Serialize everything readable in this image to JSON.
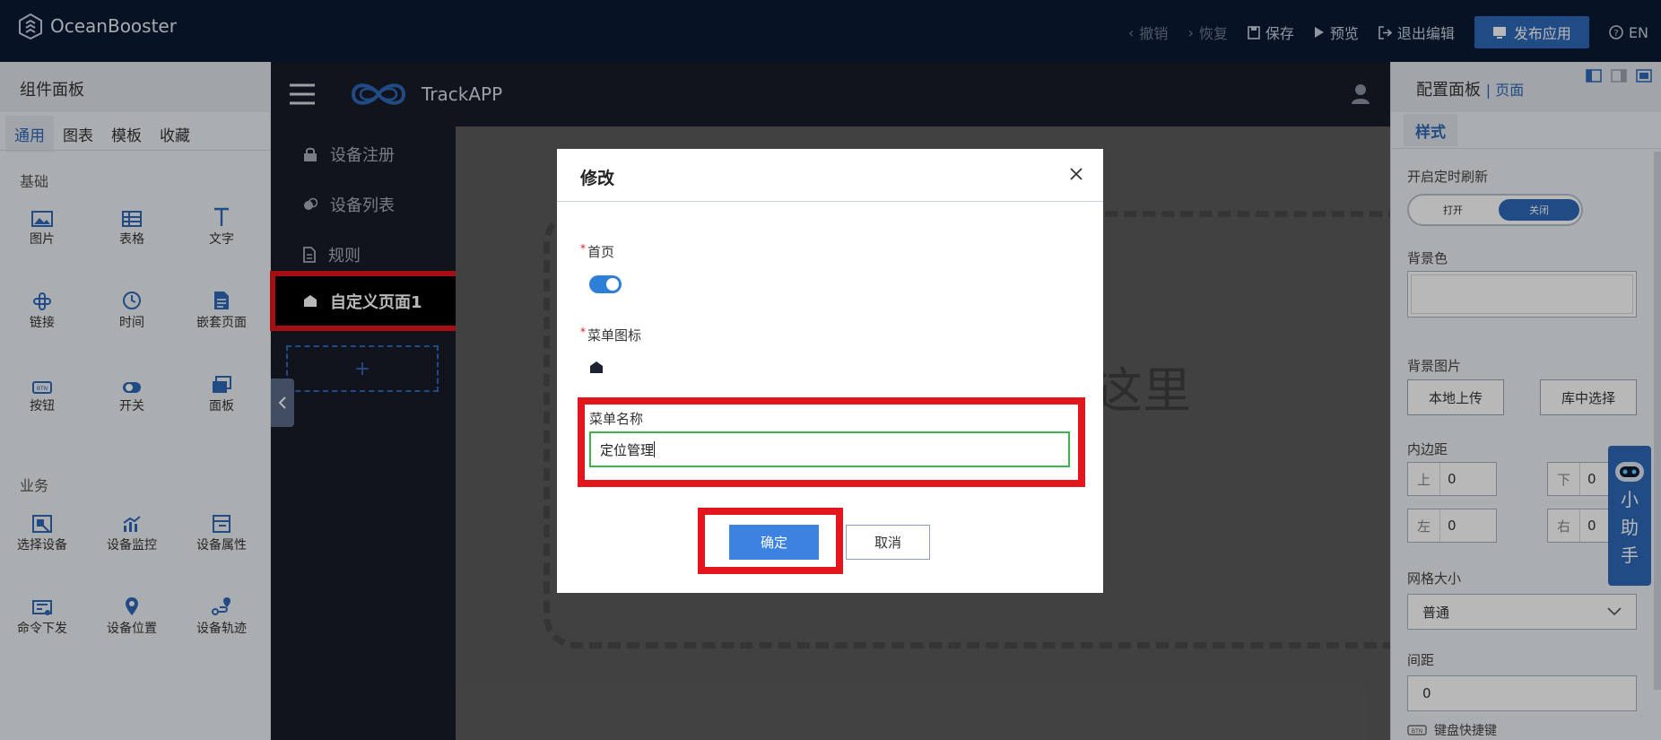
{
  "topbar": {
    "brand": "OceanBooster",
    "undo": "撤销",
    "redo": "恢复",
    "save": "保存",
    "preview": "预览",
    "exit_edit": "退出编辑",
    "publish": "发布应用",
    "language": "EN"
  },
  "left_panel": {
    "title": "组件面板",
    "tabs": [
      "通用",
      "图表",
      "模板",
      "收藏"
    ],
    "active_tab": "通用",
    "sections": {
      "basic": {
        "title": "基础",
        "items": [
          "图片",
          "表格",
          "文字",
          "链接",
          "时间",
          "嵌套页面",
          "按钮",
          "开关",
          "面板"
        ]
      },
      "business": {
        "title": "业务",
        "items": [
          "选择设备",
          "设备监控",
          "设备属性",
          "命令下发",
          "设备位置",
          "设备轨迹"
        ]
      }
    }
  },
  "app_preview": {
    "app_name": "TrackAPP",
    "menu": [
      {
        "label": "设备注册",
        "icon": "lock-icon"
      },
      {
        "label": "设备列表",
        "icon": "circles-icon"
      },
      {
        "label": "规则",
        "icon": "document-icon"
      },
      {
        "label": "自定义页面1",
        "icon": "home-icon",
        "active": true
      }
    ],
    "add_menu": "+",
    "drop_hint": "这里"
  },
  "right_panel": {
    "title": "配置面板",
    "subtitle": "页面",
    "tab": "样式",
    "auto_refresh_label": "开启定时刷新",
    "toggle_on": "打开",
    "toggle_off": "关闭",
    "bg_color_label": "背景色",
    "bg_image_label": "背景图片",
    "local_upload": "本地上传",
    "library_select": "库中选择",
    "padding_label": "内边距",
    "padding": {
      "top_label": "上",
      "top": "0",
      "bottom_label": "下",
      "bottom": "0",
      "left_label": "左",
      "left": "0",
      "right_label": "右",
      "right": "0"
    },
    "grid_size_label": "网格大小",
    "grid_size": "普通",
    "spacing_label": "间距",
    "spacing": "0",
    "shortcut_label": "键盘快捷键",
    "shortcut_badge": "BTN"
  },
  "assistant": {
    "chars": [
      "小",
      "助",
      "手"
    ]
  },
  "modal": {
    "title": "修改",
    "homepage_label": "首页",
    "homepage_enabled": true,
    "menu_icon_label": "菜单图标",
    "menu_name_label": "菜单名称",
    "menu_name_value": "定位管理",
    "confirm": "确定",
    "cancel": "取消"
  },
  "colors": {
    "topbar_bg": "#0b1b34",
    "accent": "#2e68b8",
    "highlight": "#e3161d",
    "input_focus": "#3bb54a"
  }
}
